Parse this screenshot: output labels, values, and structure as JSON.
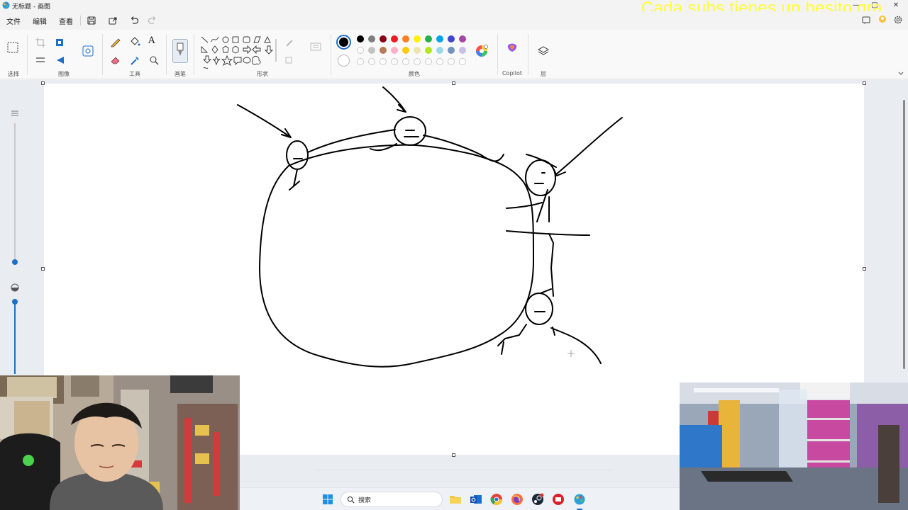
{
  "window": {
    "title": "无标题 - 画图",
    "overlay_text": "Cada subs tienes un besito gra",
    "controls": [
      "—",
      "□",
      "✕"
    ]
  },
  "menu": {
    "file": "文件",
    "edit": "编辑",
    "view": "查看"
  },
  "ribbon": {
    "groups": {
      "select": "选择",
      "image": "图像",
      "tools": "工具",
      "brushes": "画笔",
      "shapes": "形状",
      "colors": "颜色",
      "copilot": "Copilot",
      "layers": "层"
    },
    "text_tool": "A",
    "palette_row1": [
      "#000000",
      "#7f7f7f",
      "#880015",
      "#ed1c24",
      "#ff7f27",
      "#fff200",
      "#22b14c",
      "#00a2e8",
      "#3f48cc",
      "#a349a4"
    ],
    "palette_row2": [
      "#ffffff",
      "#c3c3c3",
      "#b97a57",
      "#ffaec9",
      "#ffc90e",
      "#efe4b0",
      "#b5e61d",
      "#99d9ea",
      "#7092be",
      "#c8bfe7"
    ],
    "primary_color": "#000000",
    "secondary_color": "#ffffff"
  },
  "taskbar": {
    "search_placeholder": "搜索",
    "apps": [
      "file-explorer",
      "outlook",
      "chrome",
      "firefox",
      "steam",
      "app-red",
      "paint"
    ]
  }
}
